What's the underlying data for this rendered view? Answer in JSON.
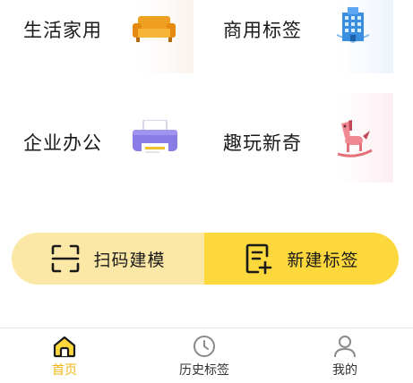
{
  "categories": [
    {
      "label": "生活家用",
      "icon": "sofa-icon"
    },
    {
      "label": "商用标签",
      "icon": "building-icon"
    },
    {
      "label": "企业办公",
      "icon": "printer-icon"
    },
    {
      "label": "趣玩新奇",
      "icon": "rocking-horse-icon"
    }
  ],
  "actions": {
    "scan_label": "扫码建模",
    "new_label": "新建标签"
  },
  "tabbar": {
    "home": "首页",
    "history": "历史标签",
    "mine": "我的"
  },
  "colors": {
    "accent": "#fdd83d",
    "accent_light": "#fbe8a6",
    "active_tab": "#f1b711"
  }
}
